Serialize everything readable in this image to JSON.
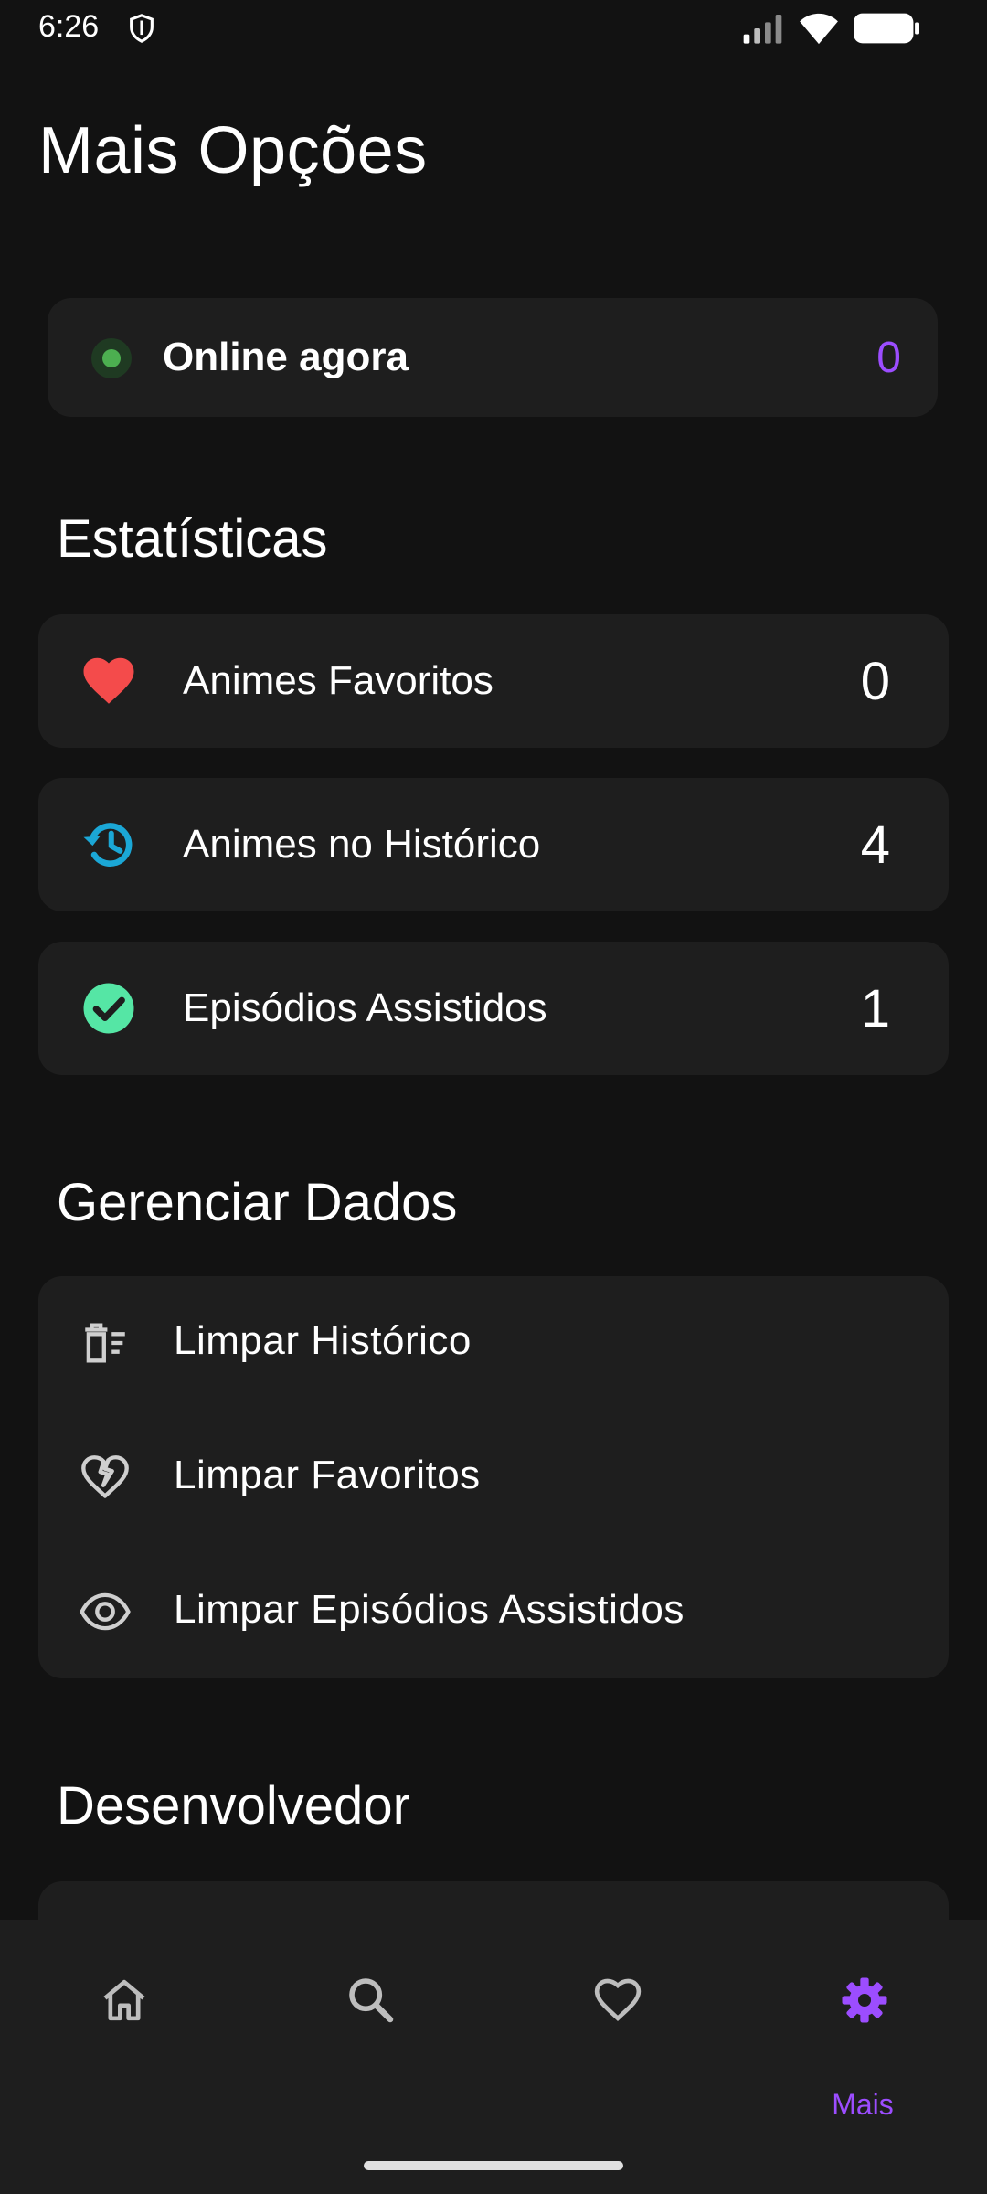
{
  "status_bar": {
    "time": "6:26",
    "icons": [
      "shield-icon",
      "signal-icon",
      "wifi-icon",
      "battery-icon"
    ]
  },
  "page_title": "Mais Opções",
  "online": {
    "label": "Online agora",
    "count": "0",
    "indicator_color": "#4caf50"
  },
  "statistics": {
    "title": "Estatísticas",
    "items": [
      {
        "icon": "heart-icon",
        "label": "Animes Favoritos",
        "value": "0",
        "icon_color": "#f44b4b"
      },
      {
        "icon": "history-icon",
        "label": "Animes no Histórico",
        "value": "4",
        "icon_color": "#1ba7d6"
      },
      {
        "icon": "check-circle-icon",
        "label": "Episódios Assistidos",
        "value": "1",
        "icon_color": "#55e6a5"
      }
    ]
  },
  "manage_data": {
    "title": "Gerenciar Dados",
    "items": [
      {
        "icon": "delete-sweep-icon",
        "label": "Limpar Histórico"
      },
      {
        "icon": "heart-broken-icon",
        "label": "Limpar Favoritos"
      },
      {
        "icon": "eye-icon",
        "label": "Limpar Episódios Assistidos"
      }
    ]
  },
  "developer": {
    "title": "Desenvolvedor"
  },
  "bottom_nav": {
    "items": [
      {
        "icon": "home-icon",
        "label": ""
      },
      {
        "icon": "search-icon",
        "label": ""
      },
      {
        "icon": "heart-outline-icon",
        "label": ""
      },
      {
        "icon": "gear-icon",
        "label": "Mais",
        "selected": true
      }
    ],
    "accent_color": "#9c4dff"
  }
}
